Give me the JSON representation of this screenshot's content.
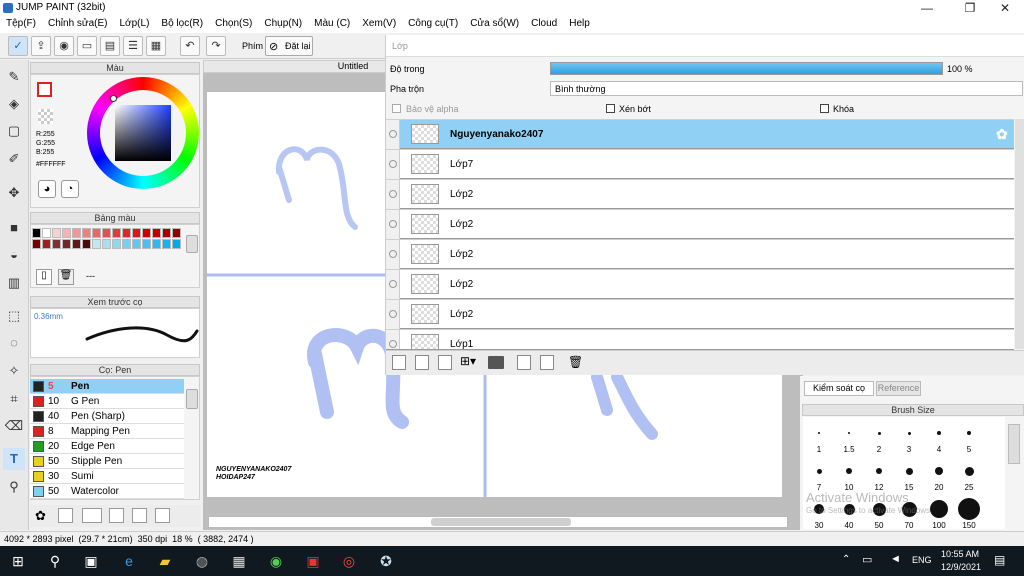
{
  "window": {
    "title": "JUMP PAINT (32bit)",
    "minimize": "—",
    "maximize": "❐",
    "close": "✕"
  },
  "menu": [
    "Tệp(F)",
    "Chỉnh sửa(E)",
    "Lớp(L)",
    "Bộ lọc(R)",
    "Chọn(S)",
    "Chụp(N)",
    "Màu (C)",
    "Xem(V)",
    "Công cụ(T)",
    "Cửa sổ(W)",
    "Cloud",
    "Help"
  ],
  "toolbar": {
    "phim": "Phím",
    "reset": "Đặt lại"
  },
  "color_panel": {
    "title": "Màu",
    "r": "R:255",
    "g": "G:255",
    "b": "B:255",
    "hex": "#FFFFFF"
  },
  "palette_panel": {
    "title": "Bảng màu",
    "dash": "---",
    "colors": [
      "#000000",
      "#ffffff",
      "#f8d0d0",
      "#f4b4b4",
      "#f09898",
      "#ec8080",
      "#e86868",
      "#e45050",
      "#e03c3c",
      "#dc2828",
      "#d81818",
      "#d00000",
      "#c00000",
      "#a80000",
      "#900000",
      "#780000",
      "#a02020",
      "#803030",
      "#702828",
      "#601818",
      "#500808",
      "#c0e8f0",
      "#a8e0f0",
      "#90d8f0",
      "#78d0f0",
      "#60c8f0",
      "#48c0f0",
      "#30b8f0",
      "#18b0f0",
      "#00a8f0"
    ]
  },
  "preview_panel": {
    "title": "Xem trước cọ",
    "size": "0.36mm"
  },
  "brush_panel": {
    "title": "Cọ: Pen",
    "items": [
      {
        "size": "5",
        "name": "Pen",
        "color": "#222222",
        "selected": true
      },
      {
        "size": "10",
        "name": "G Pen",
        "color": "#e02020"
      },
      {
        "size": "40",
        "name": "Pen (Sharp)",
        "color": "#222222"
      },
      {
        "size": "8",
        "name": "Mapping Pen",
        "color": "#e02020"
      },
      {
        "size": "20",
        "name": "Edge Pen",
        "color": "#20a020"
      },
      {
        "size": "50",
        "name": "Stipple Pen",
        "color": "#e8d020"
      },
      {
        "size": "30",
        "name": "Sumi",
        "color": "#e8d020"
      },
      {
        "size": "50",
        "name": "Watercolor",
        "color": "#80d0f0"
      }
    ]
  },
  "canvas": {
    "tab": "Untitled",
    "watermark_line1": "NGUYENYANAKO2407",
    "watermark_line2": "HOIDAP247"
  },
  "layer_panel": {
    "title": "Lớp",
    "opacity_label": "Độ trong",
    "opacity_value": "100 %",
    "opacity": 1.0,
    "blend_label": "Pha trộn",
    "blend_value": "Bình thường",
    "protect_alpha": "Bảo vệ alpha",
    "clipping": "Xén bớt",
    "lock": "Khóa",
    "layers": [
      {
        "name": "Nguyenyanako2407",
        "selected": true
      },
      {
        "name": "Lớp7"
      },
      {
        "name": "Lớp2"
      },
      {
        "name": "Lớp2"
      },
      {
        "name": "Lớp2"
      },
      {
        "name": "Lớp2"
      },
      {
        "name": "Lớp2"
      },
      {
        "name": "Lớp1"
      }
    ]
  },
  "brush_control": {
    "tab1": "Kiểm soát cọ",
    "tab2": "Reference"
  },
  "brush_size": {
    "title": "Brush Size",
    "sizes": [
      "1",
      "1.5",
      "2",
      "3",
      "4",
      "5",
      "7",
      "10",
      "12",
      "15",
      "20",
      "25",
      "30",
      "40",
      "50",
      "70",
      "100",
      "150"
    ]
  },
  "activate": {
    "line1": "Activate Windows",
    "line2": "Go to Settings to activate Windows."
  },
  "status": {
    "info": "4092 * 2893 pixel  (29.7 * 21cm)  350 dpi  18 %  ( 3882, 2474 )"
  },
  "taskbar": {
    "time": "10:55 AM",
    "date": "12/9/2021",
    "lang": "ENG"
  }
}
